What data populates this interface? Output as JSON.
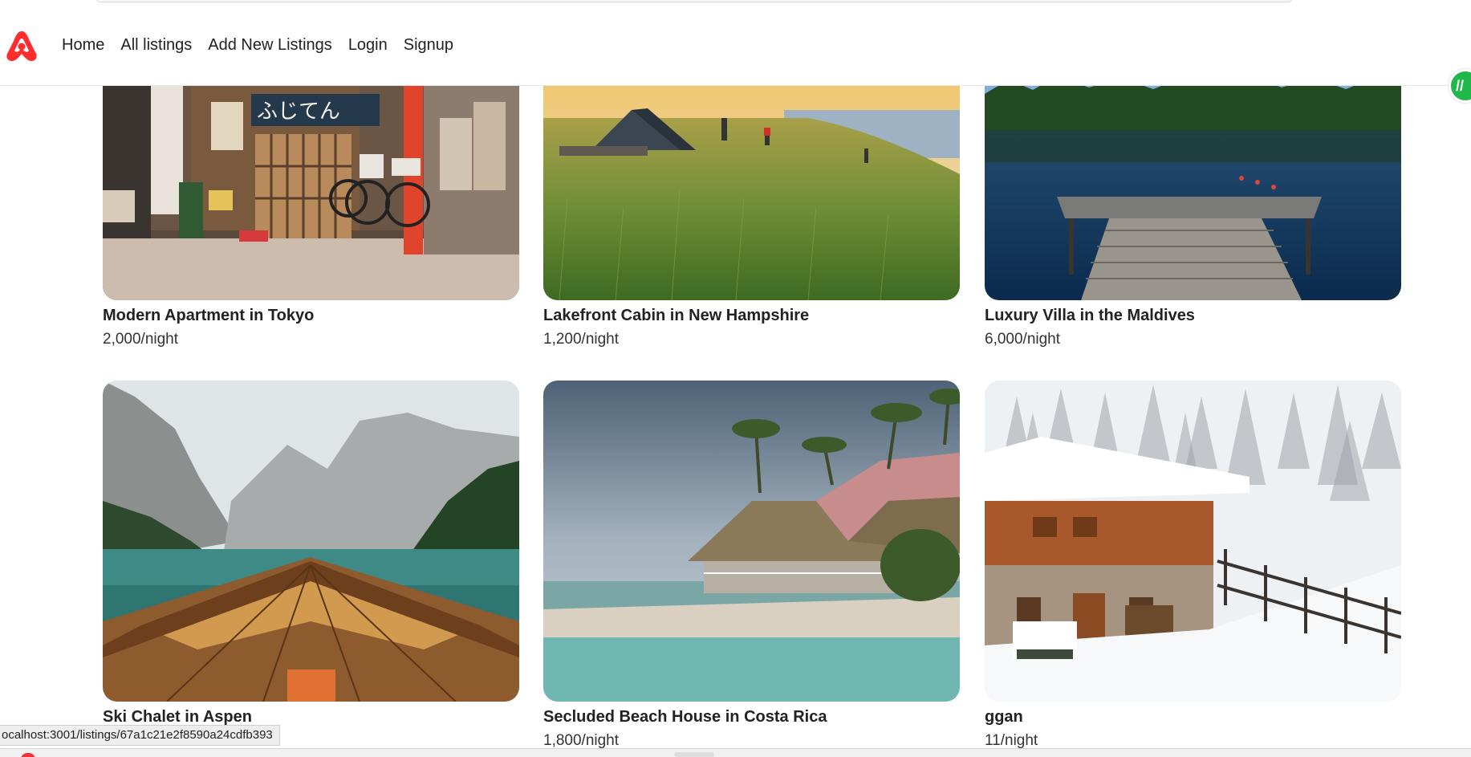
{
  "nav": {
    "brand_icon": "airbnb-logo-icon",
    "brand_color": "#ff2d2d",
    "links": [
      "Home",
      "All listings",
      "Add New Listings",
      "Login",
      "Signup"
    ]
  },
  "listings": [
    {
      "title": "Modern Apartment in Tokyo",
      "price": "2,000/night",
      "image": "tokyo-street-shopfront-image"
    },
    {
      "title": "Lakefront Cabin in New Hampshire",
      "price": "1,200/night",
      "image": "grassy-lakeshore-camping-image"
    },
    {
      "title": "Luxury Villa in the Maldives",
      "price": "6,000/night",
      "image": "lake-wooden-dock-image"
    },
    {
      "title": "Ski Chalet in Aspen",
      "price": "",
      "image": "mountain-lake-boat-image"
    },
    {
      "title": "Secluded Beach House in Costa Rica",
      "price": "1,800/night",
      "image": "tropical-beach-bungalow-image"
    },
    {
      "title": "ggan",
      "price": "11/night",
      "image": "snowy-wooden-chalet-image"
    }
  ],
  "status_bar": {
    "url": "ocalhost:3001/listings/67a1c21e2f8590a24cdfb393"
  },
  "colors": {
    "accent": "#ff2d2d",
    "extension_badge": "#20b84a"
  }
}
